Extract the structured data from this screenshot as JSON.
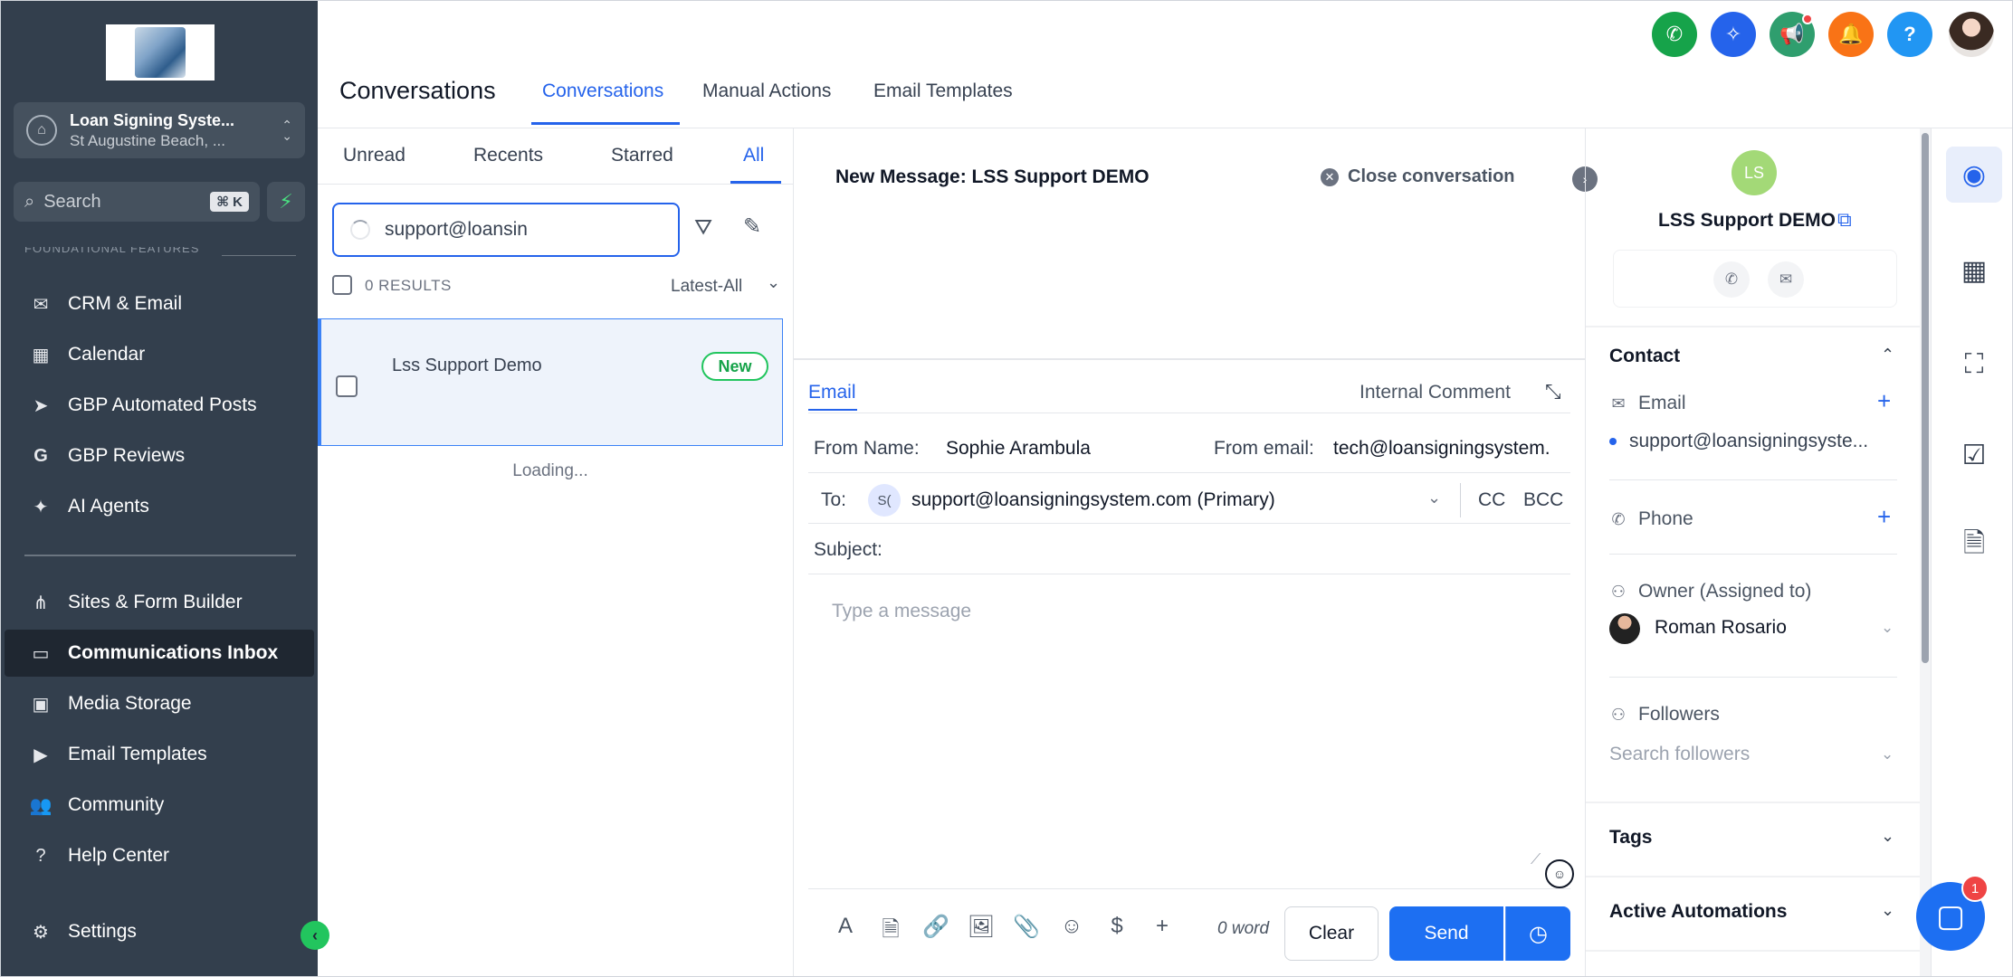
{
  "sidebar": {
    "location": {
      "name": "Loan Signing Syste...",
      "sub": "St Augustine Beach, ..."
    },
    "search": {
      "label": "Search",
      "shortcut": "⌘ K"
    },
    "section_partial": "FOUNDATIONAL FEATURES",
    "items": [
      {
        "label": "CRM & Email",
        "icon": "mail-open-icon"
      },
      {
        "label": "Calendar",
        "icon": "calendar-icon"
      },
      {
        "label": "GBP Automated Posts",
        "icon": "send-arrow-icon"
      },
      {
        "label": "GBP Reviews",
        "icon": "google-icon"
      },
      {
        "label": "AI Agents",
        "icon": "sparkles-icon"
      },
      {
        "label": "Sites & Form Builder",
        "icon": "sitemap-icon"
      },
      {
        "label": "Communications Inbox",
        "icon": "inbox-icon"
      },
      {
        "label": "Media Storage",
        "icon": "images-icon"
      },
      {
        "label": "Email Templates",
        "icon": "play-circle-icon"
      },
      {
        "label": "Community",
        "icon": "users-icon"
      },
      {
        "label": "Help Center",
        "icon": "help-circle-icon"
      },
      {
        "label": "Settings",
        "icon": "gear-icon"
      }
    ]
  },
  "header": {
    "title": "Conversations",
    "tabs": [
      "Conversations",
      "Manual Actions",
      "Email Templates"
    ],
    "colors": {
      "phone": "#16a34a",
      "ai": "#2563eb",
      "announce": "#2f9e6e",
      "bell": "#f97316",
      "help": "#2196f3"
    }
  },
  "list": {
    "filters": [
      "Unread",
      "Recents",
      "Starred",
      "All"
    ],
    "search_value": "support@loansin",
    "results": "0 RESULTS",
    "sort": "Latest-All",
    "conversation": {
      "name": "Lss Support Demo",
      "badge": "New"
    },
    "loading": "Loading..."
  },
  "compose": {
    "title": "New Message: LSS Support DEMO",
    "close_label": "Close conversation",
    "tabs": {
      "email": "Email",
      "internal": "Internal Comment"
    },
    "from_name_label": "From Name:",
    "from_name": "Sophie Arambula",
    "from_email_label": "From email:",
    "from_email": "tech@loansigningsystem.",
    "to_label": "To:",
    "to_initials": "S(",
    "to_value": "support@loansigningsystem.com (Primary)",
    "cc": "CC",
    "bcc": "BCC",
    "subject_label": "Subject:",
    "placeholder": "Type a message",
    "word_count": "0 word",
    "clear": "Clear",
    "send": "Send"
  },
  "contact": {
    "initials": "LS",
    "name": "LSS Support DEMO",
    "contact_section": "Contact",
    "email_label": "Email",
    "email_value": "support@loansigningsyste...",
    "phone_label": "Phone",
    "owner_label": "Owner (Assigned to)",
    "owner_name": "Roman Rosario",
    "followers_label": "Followers",
    "followers_placeholder": "Search followers",
    "tags": "Tags",
    "automations": "Active Automations"
  },
  "chat_badge": "1"
}
